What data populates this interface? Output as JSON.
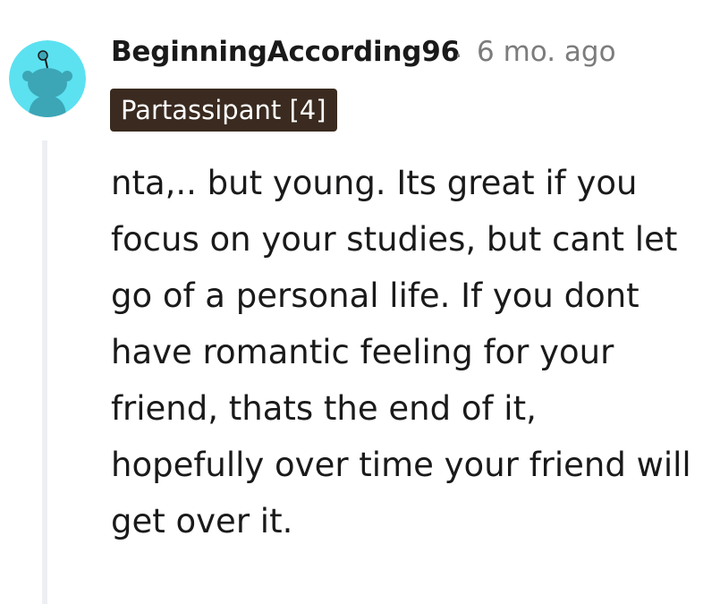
{
  "comment": {
    "avatar_icon": "snoo-avatar-icon",
    "avatar_color": "#5ce1f0",
    "username": "BeginningAccording96",
    "separator": "·",
    "timestamp": "6 mo. ago",
    "flair": "Partassipant [4]",
    "flair_color": "#3a2a1f",
    "body": "nta,.. but young. Its great if you focus on your studies, but cant let go of a personal life. If you dont have romantic feeling for your friend, thats the end of it, hopefully over time your friend will get over it."
  }
}
